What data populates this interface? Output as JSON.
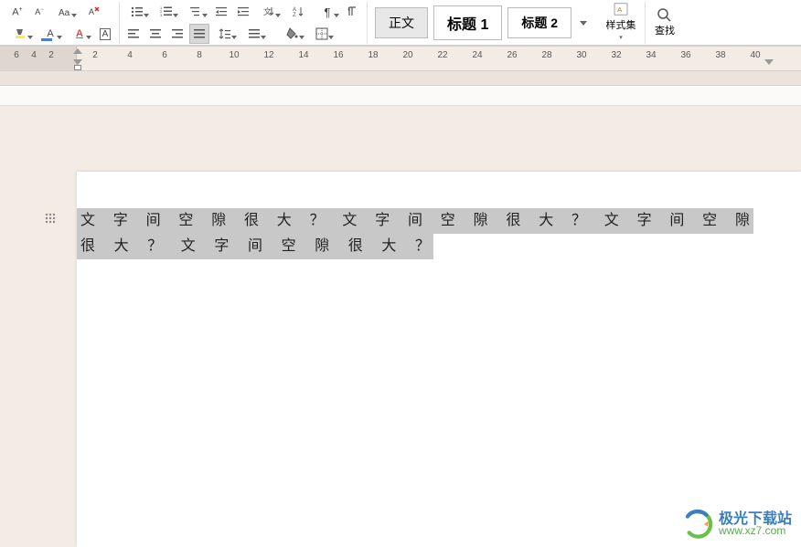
{
  "ribbon": {
    "font_group": {
      "increase_font": "A+",
      "decrease_font": "A−",
      "change_case": "Aa",
      "clear_format": "清",
      "highlight": "高",
      "font_color": "A",
      "char_border": "A",
      "char_shading": "A",
      "phonetic": "拼"
    },
    "paragraph_group": {
      "bullets": "项目符号",
      "numbering": "编号",
      "multilevel": "多级",
      "decrease_indent": "减缩",
      "increase_indent": "增缩",
      "sort": "排序",
      "show_marks": "¶",
      "align_left": "左",
      "align_center": "中",
      "align_right": "右",
      "justify": "两端",
      "line_spacing": "行距",
      "shading": "底纹",
      "borders": "边框"
    },
    "styles": {
      "normal": "正文",
      "heading1": "标题 1",
      "heading2": "标题 2"
    },
    "styleset_label": "样式集",
    "find_label": "查找"
  },
  "ruler": {
    "ticks": [
      6,
      4,
      2,
      2,
      4,
      6,
      8,
      10,
      12,
      14,
      16,
      18,
      20,
      22,
      24,
      26,
      28,
      30,
      32,
      34,
      36,
      38,
      40
    ]
  },
  "document": {
    "line1": "文字间空隙很大？文字间空隙很大？文字间空隙",
    "line2": "很大？文字间空隙很大？"
  },
  "move_handle_icon": "⠿",
  "watermark": {
    "brand": "极光下载站",
    "url": "www.xz7.com"
  }
}
